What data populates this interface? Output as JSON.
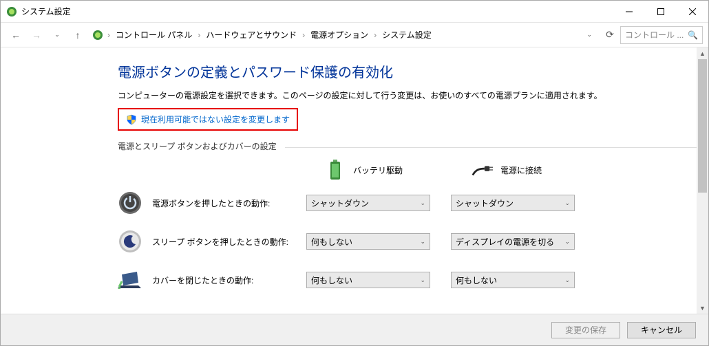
{
  "window": {
    "title": "システム設定"
  },
  "breadcrumb": {
    "items": [
      "コントロール パネル",
      "ハードウェアとサウンド",
      "電源オプション",
      "システム設定"
    ]
  },
  "search": {
    "placeholder": "コントロール ..."
  },
  "page": {
    "heading": "電源ボタンの定義とパスワード保護の有効化",
    "description": "コンピューターの電源設定を選択できます。このページの設定に対して行う変更は、お使いのすべての電源プランに適用されます。",
    "admin_link": "現在利用可能ではない設定を変更します",
    "fieldset_label": "電源とスリープ ボタンおよびカバーの設定",
    "columns": {
      "battery": "バッテリ駆動",
      "plugged": "電源に接続"
    },
    "rows": [
      {
        "label": "電源ボタンを押したときの動作:",
        "battery_value": "シャットダウン",
        "plugged_value": "シャットダウン",
        "icon": "power"
      },
      {
        "label": "スリープ ボタンを押したときの動作:",
        "battery_value": "何もしない",
        "plugged_value": "ディスプレイの電源を切る",
        "icon": "sleep"
      },
      {
        "label": "カバーを閉じたときの動作:",
        "battery_value": "何もしない",
        "plugged_value": "何もしない",
        "icon": "lid"
      }
    ]
  },
  "footer": {
    "save": "変更の保存",
    "cancel": "キャンセル"
  }
}
